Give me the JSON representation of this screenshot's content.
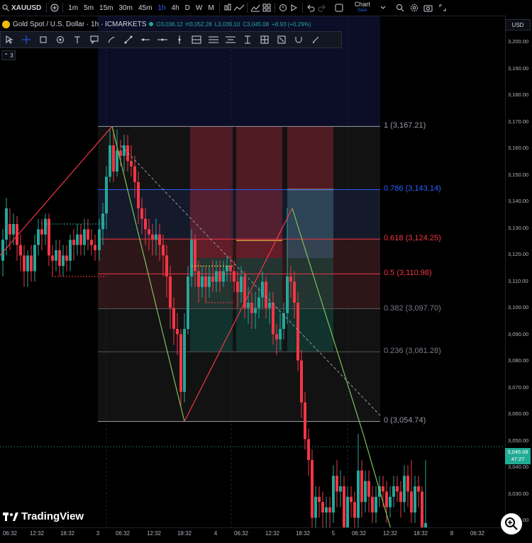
{
  "toolbar": {
    "symbol": "XAUUSD",
    "intervals": [
      "1m",
      "5m",
      "15m",
      "30m",
      "45m",
      "1h",
      "4h",
      "D",
      "W",
      "M"
    ],
    "active_interval": "1h",
    "chart_label": "Chart",
    "save_label": "Save"
  },
  "legend": {
    "title": "Gold Spot / U.S. Dollar · 1h · ICMARKETS",
    "open": "O3,036.12",
    "high": "H3,052.28",
    "low": "L3,036.10",
    "close": "C3,045.08",
    "change": "+8.93 (+0.29%)"
  },
  "indicators_count": "3",
  "currency": "USD",
  "price_axis": [
    "3,200.00",
    "3,190.00",
    "3,180.00",
    "3,170.00",
    "3,160.00",
    "3,150.00",
    "3,140.00",
    "3,130.00",
    "3,120.00",
    "3,110.00",
    "3,100.00",
    "3,090.00",
    "3,080.00",
    "3,070.00",
    "3,060.00",
    "3,050.00",
    "3,040.00",
    "3,030.00",
    "3,020.00"
  ],
  "current_price": {
    "price": "3,045.08",
    "countdown": "47:27"
  },
  "time_axis": [
    "06:32",
    "12:32",
    "18:32",
    "3",
    "06:32",
    "12:32",
    "18:32",
    "4",
    "06:32",
    "12:32",
    "18:32",
    "5",
    "06:32",
    "12:32",
    "18:32",
    "8",
    "06:32"
  ],
  "fib_levels": [
    {
      "label": "1 (3,167.21)",
      "color": "#9598a1"
    },
    {
      "label": "0.786 (3,143.14)",
      "color": "#2962ff"
    },
    {
      "label": "0.618 (3,124.25)",
      "color": "#f23645"
    },
    {
      "label": "0.5 (3,110.98)",
      "color": "#f23645"
    },
    {
      "label": "0.382 (3,097.70)",
      "color": "#787b86"
    },
    {
      "label": "0.236 (3,081.28)",
      "color": "#787b86"
    },
    {
      "label": "0 (3,054.74)",
      "color": "#9598a1"
    }
  ],
  "brand": "TradingView",
  "colors": {
    "up": "#26a69a",
    "down": "#f23645",
    "accent": "#2962ff"
  }
}
